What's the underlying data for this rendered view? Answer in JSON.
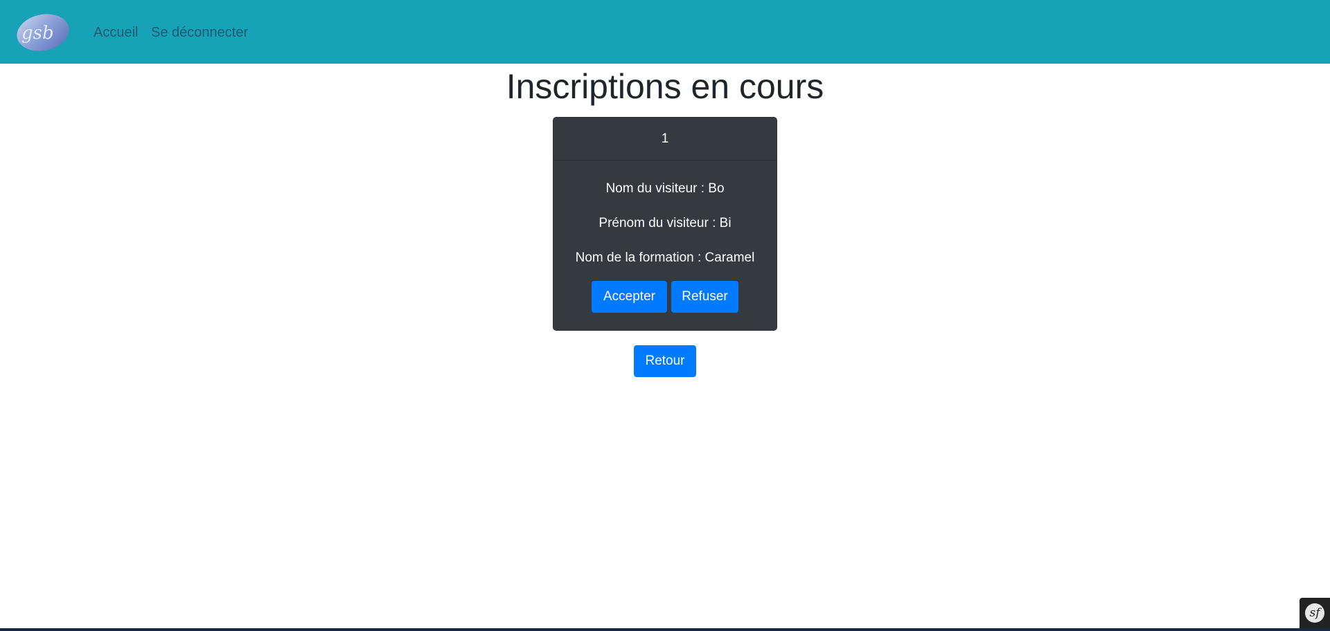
{
  "navbar": {
    "logo_text": "gsb",
    "links": [
      {
        "label": "Accueil"
      },
      {
        "label": "Se déconnecter"
      }
    ],
    "background_color": "#17a2b8"
  },
  "page": {
    "title": "Inscriptions en cours"
  },
  "inscription_card": {
    "header": "1",
    "visitor_name_line": "Nom du visiteur : Bo",
    "visitor_firstname_line": "Prénom du visiteur : Bi",
    "training_name_line": "Nom de la formation : Caramel",
    "accept_label": "Accepter",
    "refuse_label": "Refuser",
    "background_color": "#343a40"
  },
  "actions": {
    "back_label": "Retour"
  },
  "debug_toolbar": {
    "icon": "symfony-icon",
    "glyph": "sf"
  },
  "colors": {
    "primary_button": "#007bff",
    "title_text": "#212529"
  }
}
